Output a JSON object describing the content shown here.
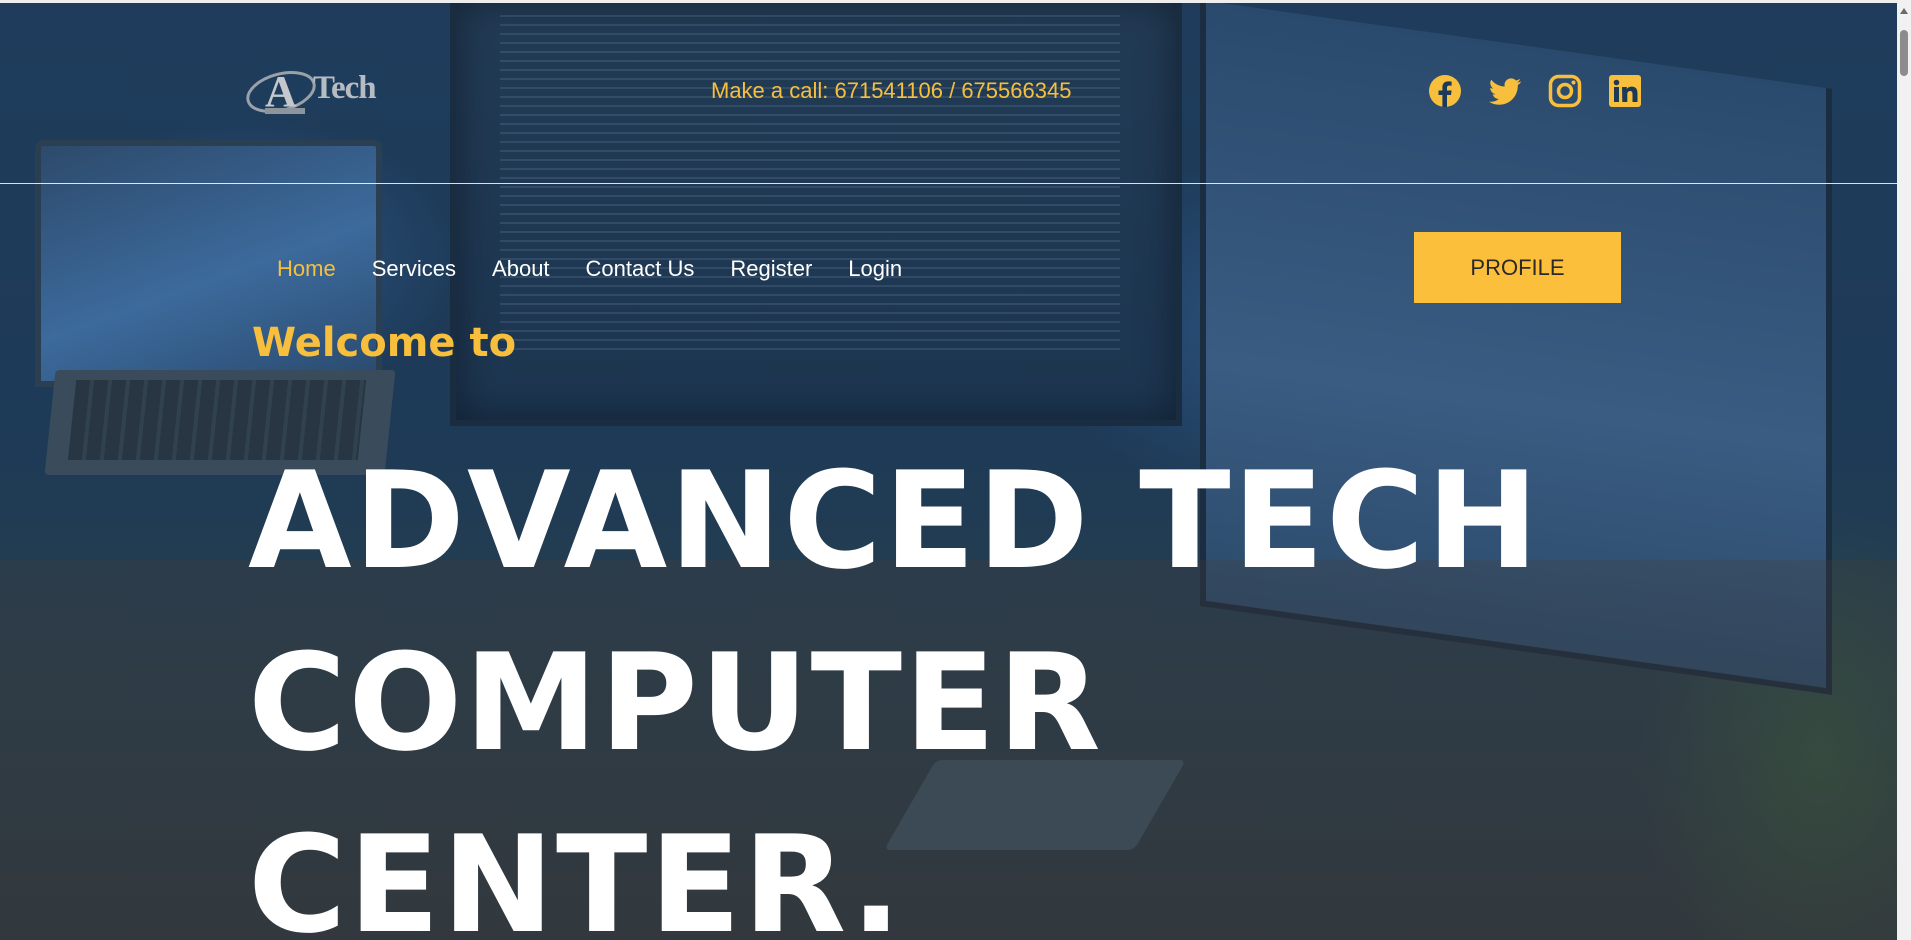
{
  "brand": {
    "logo_text": "Tech",
    "logo_initial": "A"
  },
  "header": {
    "phone_text": "Make a call: 671541106 / 675566345",
    "socials": [
      {
        "icon": "facebook-icon"
      },
      {
        "icon": "twitter-icon"
      },
      {
        "icon": "instagram-icon"
      },
      {
        "icon": "linkedin-icon"
      }
    ]
  },
  "nav": {
    "items": [
      {
        "label": "Home",
        "active": true
      },
      {
        "label": "Services"
      },
      {
        "label": "About"
      },
      {
        "label": "Contact Us"
      },
      {
        "label": "Register"
      },
      {
        "label": "Login"
      }
    ],
    "profile_label": "PROFILE"
  },
  "hero": {
    "welcome": "Welcome to",
    "lines": [
      "ADVANCED TECH",
      "COMPUTER",
      "CENTER."
    ]
  },
  "colors": {
    "accent": "#f8bf3d",
    "button": "#fbbf3c",
    "overlay": "#1c3a58",
    "text": "#ffffff"
  }
}
